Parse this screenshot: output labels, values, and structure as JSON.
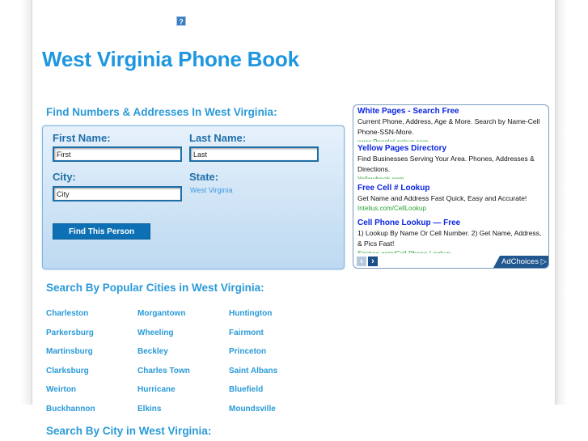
{
  "header": {
    "help_icon": "?",
    "title": "West Virginia Phone Book"
  },
  "search_form": {
    "heading": "Find Numbers & Addresses In West Virginia:",
    "first_name_label": "First Name:",
    "first_name_value": "First",
    "last_name_label": "Last Name:",
    "last_name_value": "Last",
    "city_label": "City:",
    "city_value": "City",
    "state_label": "State:",
    "state_value": "West Virginia",
    "submit_label": "Find This Person"
  },
  "ads": {
    "items": [
      {
        "title": "White Pages - Search Free",
        "description": "Current Phone, Address, Age & More. Search by Name-Cell Phone-SSN-More.",
        "url": "www.PeopleLookup.com"
      },
      {
        "title": "Yellow Pages Directory",
        "description": "Find Businesses Serving Your Area. Phones, Addresses & Directions.",
        "url": "Yellowbook.com"
      },
      {
        "title": "Free Cell # Lookup",
        "description": "Get Name and Address Fast Quick, Easy and Accurate!",
        "url": "Intelius.com/CellLookup"
      },
      {
        "title": "Cell Phone Lookup — Free",
        "description": "1) Lookup By Name Or Cell Number. 2) Get Name, Address, & Pics Fast!",
        "url": "Spokeo.com/Cell-Phone-Lookup"
      }
    ],
    "prev_icon": "‹",
    "next_icon": "›",
    "adchoices_label": "AdChoices ▷"
  },
  "popular_cities": {
    "heading": "Search By Popular Cities in West Virginia:",
    "cities": [
      "Charleston",
      "Morgantown",
      "Huntington",
      "Parkersburg",
      "Wheeling",
      "Fairmont",
      "Martinsburg",
      "Beckley",
      "Princeton",
      "Clarksburg",
      "Charles Town",
      "Saint Albans",
      "Weirton",
      "Hurricane",
      "Bluefield",
      "Buckhannon",
      "Elkins",
      "Moundsville"
    ]
  },
  "city_search": {
    "heading": "Search By City in West Virginia:"
  }
}
